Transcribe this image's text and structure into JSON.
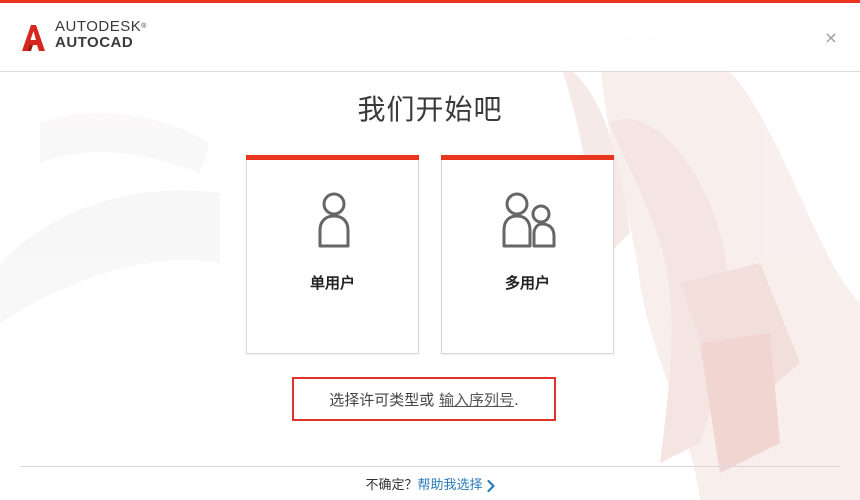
{
  "header": {
    "brand_line1": "AUTODESK",
    "brand_tm": "®",
    "brand_line2": "AUTOCAD",
    "close_glyph": "×",
    "logo_icon": "autocad-a-logo",
    "accent_color": "#e8361f"
  },
  "main": {
    "title": "我们开始吧",
    "cards": [
      {
        "label": "单用户",
        "icon": "single-user-icon"
      },
      {
        "label": "多用户",
        "icon": "multi-user-icon"
      }
    ]
  },
  "license": {
    "prompt": "选择许可类型或",
    "serial_link": "输入序列号",
    "suffix": ".",
    "highlight_color": "#e0342a"
  },
  "footer": {
    "question": "不确定？",
    "help_link": "帮助我选择",
    "link_color": "#2a7ab8",
    "chevron_icon": "chevron-right-icon"
  }
}
